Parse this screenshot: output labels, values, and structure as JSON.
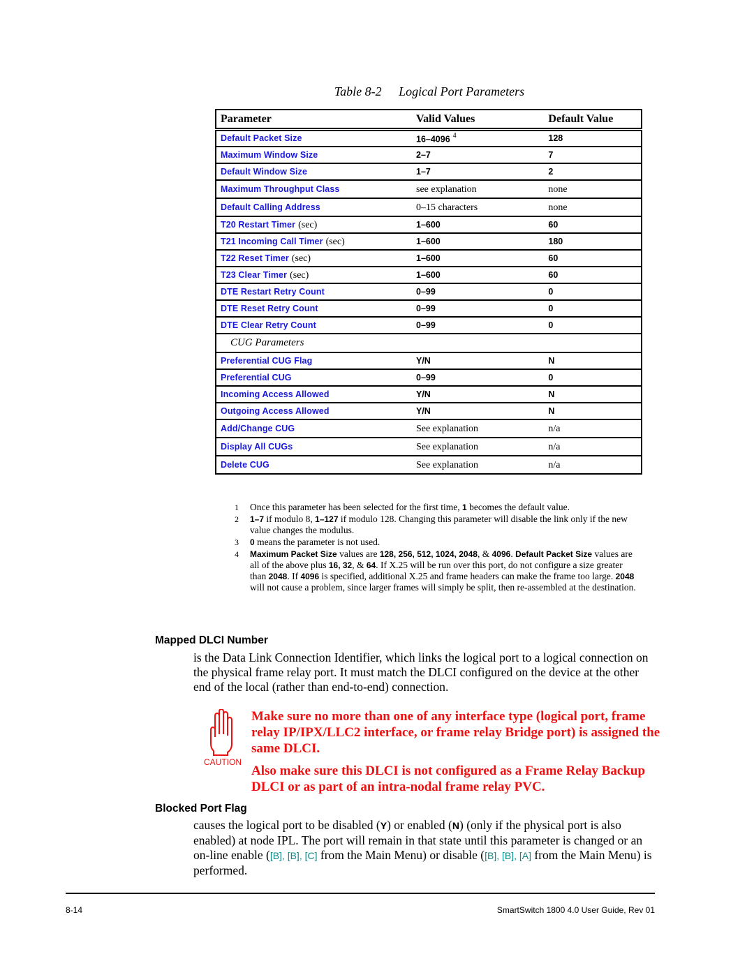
{
  "table": {
    "number": "Table 8-2",
    "title": "Logical Port Parameters",
    "headers": [
      "Parameter",
      "Valid Values",
      "Default Value"
    ],
    "rows": [
      {
        "param": "Default Packet Size",
        "unit": "",
        "valid": "16–4096",
        "valid_note": "4",
        "valid_style": "bold",
        "default": "128",
        "default_style": "bold"
      },
      {
        "param": "Maximum Window Size",
        "unit": "",
        "valid": "2–7",
        "valid_style": "bold",
        "default": "7",
        "default_style": "bold"
      },
      {
        "param": "Default Window Size",
        "unit": "",
        "valid": "1–7",
        "valid_style": "bold",
        "default": "2",
        "default_style": "bold"
      },
      {
        "param": "Maximum Throughput Class",
        "unit": "",
        "valid": "see explanation",
        "valid_style": "plain",
        "default": "none",
        "default_style": "plain"
      },
      {
        "param": "Default Calling Address",
        "unit": "",
        "valid": "0–15 characters",
        "valid_style": "plain",
        "default": "none",
        "default_style": "plain"
      },
      {
        "param": "T20 Restart Timer",
        "unit": "(sec)",
        "valid": "1–600",
        "valid_style": "bold",
        "default": "60",
        "default_style": "bold"
      },
      {
        "param": "T21 Incoming Call Timer",
        "unit": "(sec)",
        "valid": "1–600",
        "valid_style": "bold",
        "default": "180",
        "default_style": "bold"
      },
      {
        "param": "T22 Reset Timer",
        "unit": "(sec)",
        "valid": "1–600",
        "valid_style": "bold",
        "default": "60",
        "default_style": "bold"
      },
      {
        "param": "T23 Clear Timer",
        "unit": "(sec)",
        "valid": "1–600",
        "valid_style": "bold",
        "default": "60",
        "default_style": "bold"
      },
      {
        "param": "DTE Restart Retry Count",
        "unit": "",
        "valid": "0–99",
        "valid_style": "bold",
        "default": "0",
        "default_style": "bold"
      },
      {
        "param": "DTE Reset Retry Count",
        "unit": "",
        "valid": "0–99",
        "valid_style": "bold",
        "default": "0",
        "default_style": "bold"
      },
      {
        "param": "DTE Clear Retry Count",
        "unit": "",
        "valid": "0–99",
        "valid_style": "bold",
        "default": "0",
        "default_style": "bold"
      }
    ],
    "section_label": "CUG Parameters",
    "cug_rows": [
      {
        "param": "Preferential CUG Flag",
        "valid": "Y/N",
        "valid_style": "bold",
        "default": "N",
        "default_style": "bold"
      },
      {
        "param": "Preferential CUG",
        "valid": "0–99",
        "valid_style": "bold",
        "default": "0",
        "default_style": "bold"
      },
      {
        "param": "Incoming Access Allowed",
        "valid": "Y/N",
        "valid_style": "bold",
        "default": "N",
        "default_style": "bold"
      },
      {
        "param": "Outgoing Access Allowed",
        "valid": "Y/N",
        "valid_style": "bold",
        "default": "N",
        "default_style": "bold"
      },
      {
        "param": "Add/Change CUG",
        "valid": "See explanation",
        "valid_style": "plain",
        "default": "n/a",
        "default_style": "plain"
      },
      {
        "param": "Display All CUGs",
        "valid": "See explanation",
        "valid_style": "plain",
        "default": "n/a",
        "default_style": "plain"
      },
      {
        "param": "Delete CUG",
        "valid": "See explanation",
        "valid_style": "plain",
        "default": "n/a",
        "default_style": "plain"
      }
    ]
  },
  "footnotes": [
    {
      "num": "1",
      "parts": [
        {
          "t": "Once this parameter has been selected for the first time, "
        },
        {
          "t": "1",
          "b": true
        },
        {
          "t": " becomes the default value."
        }
      ]
    },
    {
      "num": "2",
      "parts": [
        {
          "t": "1–7",
          "b": true
        },
        {
          "t": " if modulo 8, "
        },
        {
          "t": "1–127",
          "b": true
        },
        {
          "t": " if modulo 128. Changing this parameter will disable the link only if the new value changes the modulus."
        }
      ]
    },
    {
      "num": "3",
      "parts": [
        {
          "t": "0",
          "b": true
        },
        {
          "t": " means the parameter is not used."
        }
      ]
    },
    {
      "num": "4",
      "parts": [
        {
          "t": "Maximum Packet Size",
          "b": true
        },
        {
          "t": " values are "
        },
        {
          "t": "128, 256, 512, 1024, 2048",
          "b": true
        },
        {
          "t": ", & "
        },
        {
          "t": "4096",
          "b": true
        },
        {
          "t": ". "
        },
        {
          "t": "Default Packet Size",
          "b": true
        },
        {
          "t": " values are all of the above plus "
        },
        {
          "t": "16, 32",
          "b": true
        },
        {
          "t": ", & "
        },
        {
          "t": "64",
          "b": true
        },
        {
          "t": ". If X.25 will be run over this port, do not configure a size greater than "
        },
        {
          "t": "2048",
          "b": true
        },
        {
          "t": ". If "
        },
        {
          "t": "4096",
          "b": true
        },
        {
          "t": " is specified, additional X.25 and frame headers can make the frame too large. "
        },
        {
          "t": "2048",
          "b": true
        },
        {
          "t": " will not cause a problem, since larger frames will simply be split, then re-assembled at the destination."
        }
      ]
    }
  ],
  "mapped_dlci": {
    "heading": "Mapped DLCI Number",
    "body": "is the Data Link Connection Identifier, which links the logical port to a logical connection on the physical frame relay port. It must match the DLCI configured on the device at the other end of the local (rather than end-to-end) connection."
  },
  "caution": {
    "icon_label": "CAUTION",
    "icon": "caution-hand-icon",
    "color": "#ee1111",
    "line1": "Make sure no more than one of any interface type (logical port, frame relay IP/IPX/LLC2 interface, or frame relay Bridge port) is assigned the same DLCI.",
    "line2": "Also make sure this DLCI is not configured as a Frame Relay Backup DLCI or as part of an intra-nodal frame relay PVC."
  },
  "blocked_port": {
    "heading": "Blocked Port Flag",
    "text1": "causes the logical port to be disabled (",
    "y": "Y",
    "text2": ") or enabled (",
    "n": "N",
    "text3": ") (only if the physical port is also enabled) at node IPL. The port will remain in that state until this parameter is changed or an on-line enable (",
    "enable_keys": "[B], [B], [C]",
    "text4": " from the Main Menu) or disable (",
    "disable_keys": "[B], [B], [A]",
    "text5": " from the Main Menu) is performed.",
    "key_color": "#118888"
  },
  "footer": {
    "page": "8-14",
    "doc": "SmartSwitch 1800 4.0 User Guide, Rev 01"
  }
}
